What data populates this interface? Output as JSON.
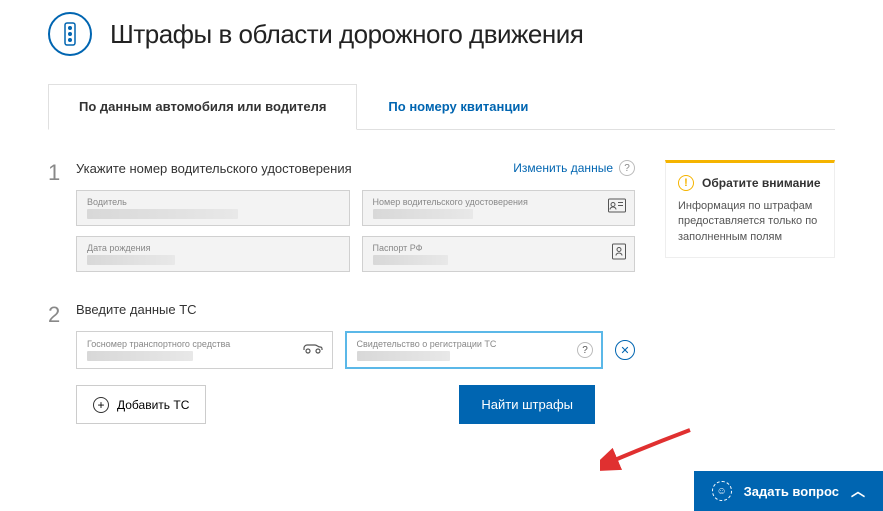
{
  "header": {
    "title": "Штрафы в области дорожного движения"
  },
  "tabs": {
    "active": "По данным автомобиля или водителя",
    "inactive": "По номеру квитанции"
  },
  "s1": {
    "num": "1",
    "title": "Укажите номер водительского удостоверения",
    "change": "Изменить данные",
    "f_driver": "Водитель",
    "f_license": "Номер водительского удостоверения",
    "f_dob": "Дата рождения",
    "f_passport": "Паспорт РФ"
  },
  "s2": {
    "num": "2",
    "title": "Введите данные ТС",
    "f_plate": "Госномер транспортного средства",
    "f_reg": "Свидетельство о регистрации ТС"
  },
  "warn": {
    "title": "Обратите внимание",
    "text": "Информация по штрафам предоставляется только по заполненным полям"
  },
  "actions": {
    "add": "Добавить ТС",
    "find": "Найти штрафы"
  },
  "widget": {
    "label": "Задать вопрос"
  }
}
